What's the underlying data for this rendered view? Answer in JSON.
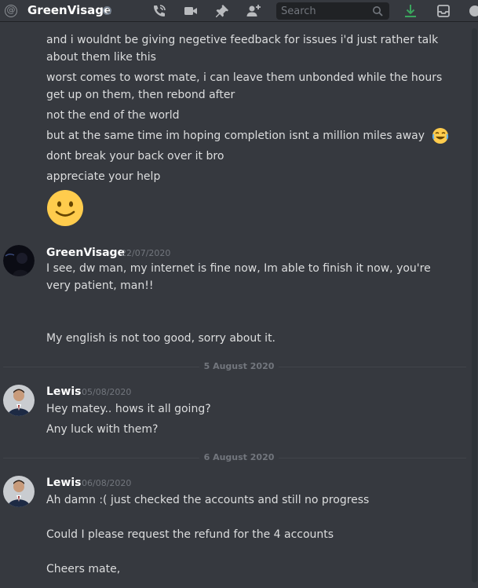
{
  "header": {
    "channel_name": "GreenVisage",
    "status": "offline",
    "search_placeholder": "Search",
    "icons": [
      "at-icon",
      "call-icon",
      "video-icon",
      "pin-icon",
      "add-friend-icon",
      "search-icon",
      "download-icon",
      "inbox-icon"
    ]
  },
  "messages": {
    "top_lines": [
      "and i wouldnt be giving negetive feedback for issues i'd just rather talk about them like this",
      "worst comes to worst mate, i can leave them unbonded while the hours get up on them, then rebond after",
      "not the end of the world",
      "but at the same time im hoping completion isnt a million miles away",
      "dont break your back over it bro",
      "appreciate your help"
    ],
    "greenvisage": {
      "author": "GreenVisage",
      "timestamp": "22/07/2020",
      "line1": "I see, dw man, my internet is fine now, Im able to finish it now, you're very patient, man!!",
      "line2": "My english is not too good, sorry about it."
    },
    "divider1": "5 August 2020",
    "lewis1": {
      "author": "Lewis",
      "timestamp": "05/08/2020",
      "line1": "Hey matey.. hows it all going?",
      "line2": "Any luck with them?"
    },
    "divider2": "6 August 2020",
    "lewis2": {
      "author": "Lewis",
      "timestamp": "06/08/2020",
      "line1": "Ah damn :( just checked the accounts and still no progress",
      "line2": "Could I please request the refund for the 4 accounts",
      "line3": "Cheers mate,"
    }
  },
  "colors": {
    "background": "#36393f",
    "text": "#dcddde",
    "author": "#ffffff",
    "muted": "#72767d",
    "accent_download": "#3ba55d"
  }
}
